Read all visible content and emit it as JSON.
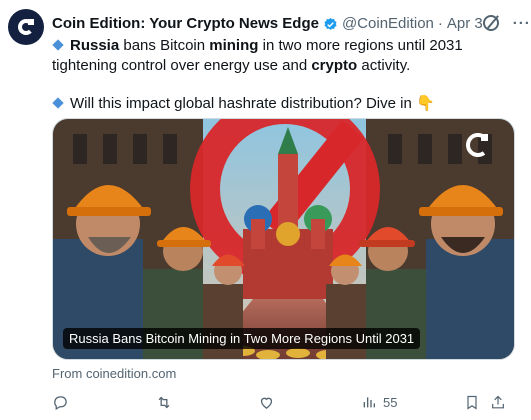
{
  "tweet": {
    "author_name": "Coin Edition: Your Crypto News Edge",
    "handle": "@CoinEdition",
    "separator": "·",
    "date": "Apr 3",
    "text_1_a": "Russia",
    "text_1_b": " bans Bitcoin ",
    "text_1_c": "mining",
    "text_1_d": " in two more regions until 2031 tightening control over energy use and ",
    "text_1_e": "crypto",
    "text_1_f": " activity.",
    "text_2": "Will this impact global hashrate distribution? Dive in",
    "emoji_hand": "👇"
  },
  "card": {
    "caption": "Russia Bans Bitcoin Mining in Two More Regions Until 2031",
    "source": "From coinedition.com"
  },
  "actions": {
    "views": "55"
  },
  "icons": {
    "avatar": "coin-edition-logo",
    "verified": "verified-badge-icon",
    "grok": "grok-icon",
    "more": "more-dots-icon",
    "reply": "reply-icon",
    "repost": "repost-icon",
    "like": "heart-icon",
    "views": "views-chart-icon",
    "bookmark": "bookmark-icon",
    "share": "share-icon"
  },
  "colors": {
    "verified": "#1d9bf0",
    "secondary_text": "#536471",
    "diamond": "#4a90d9"
  }
}
